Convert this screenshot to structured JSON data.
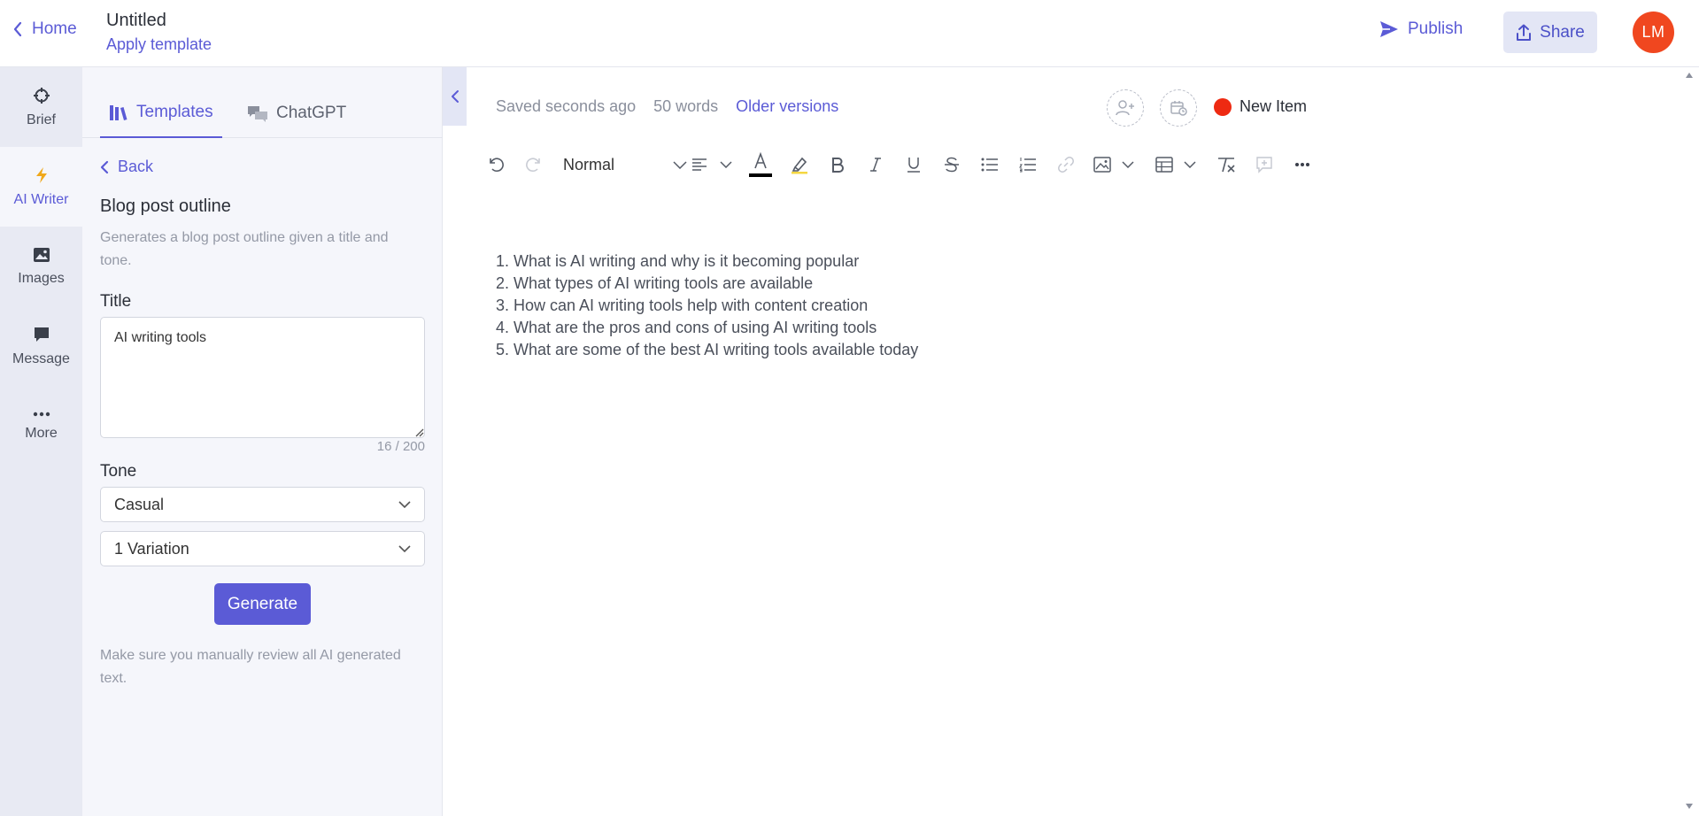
{
  "header": {
    "home_label": "Home",
    "title": "Untitled",
    "apply_template_label": "Apply template",
    "publish_label": "Publish",
    "share_label": "Share",
    "avatar_initials": "LM"
  },
  "sidebar": {
    "items": [
      {
        "label": "Brief",
        "icon": "crosshair-icon"
      },
      {
        "label": "AI Writer",
        "icon": "lightning-icon"
      },
      {
        "label": "Images",
        "icon": "image-icon"
      },
      {
        "label": "Message",
        "icon": "chat-bubble-icon"
      },
      {
        "label": "More",
        "icon": "ellipsis-icon"
      }
    ],
    "active": "AI Writer"
  },
  "panel": {
    "tabs": [
      {
        "label": "Templates",
        "icon": "books-icon"
      },
      {
        "label": "ChatGPT",
        "icon": "chat-bubbles-icon"
      }
    ],
    "back_label": "Back",
    "template_title": "Blog post outline",
    "template_description": "Generates a blog post outline given a title and tone.",
    "title_label": "Title",
    "title_value": "AI writing tools",
    "char_counter": "16 / 200",
    "tone_label": "Tone",
    "tone_value": "Casual",
    "variation_value": "1 Variation",
    "generate_label": "Generate",
    "note": "Make sure you manually review all AI generated text."
  },
  "editor": {
    "saved_status": "Saved seconds ago",
    "word_count": "50 words",
    "older_versions_label": "Older versions",
    "new_item_label": "New Item",
    "status_color": "#ee2a12",
    "format_value": "Normal",
    "content": [
      "1. What is AI writing and why is it becoming popular",
      "2. What types of AI writing tools are available",
      "3. How can AI writing tools help with content creation",
      "4. What are the pros and cons of using AI writing tools",
      "5. What are some of the best AI writing tools available today"
    ]
  },
  "colors": {
    "accent": "#5b5bd6",
    "avatar": "#f0471f",
    "rail_bg": "#e8eaf3",
    "panel_bg": "#f5f6fb"
  }
}
